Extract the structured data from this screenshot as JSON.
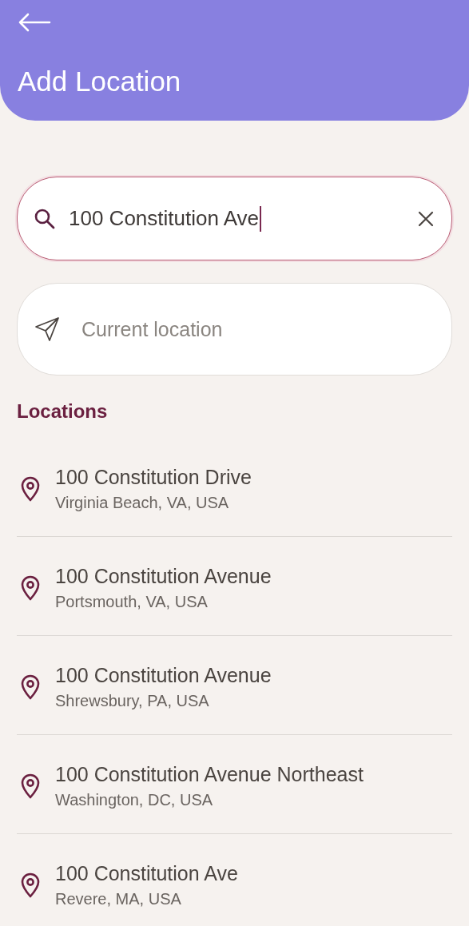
{
  "header": {
    "title": "Add Location"
  },
  "search": {
    "value": "100 Constitution Ave",
    "focused": true
  },
  "current_location": {
    "label": "Current location"
  },
  "locations": {
    "heading": "Locations",
    "items": [
      {
        "name": "100 Constitution Drive",
        "address": "Virginia Beach, VA, USA"
      },
      {
        "name": "100 Constitution Avenue",
        "address": "Portsmouth, VA, USA"
      },
      {
        "name": "100 Constitution Avenue",
        "address": "Shrewsbury, PA, USA"
      },
      {
        "name": "100 Constitution Avenue Northeast",
        "address": "Washington, DC, USA"
      },
      {
        "name": "100 Constitution Ave",
        "address": "Revere, MA, USA"
      }
    ]
  }
}
